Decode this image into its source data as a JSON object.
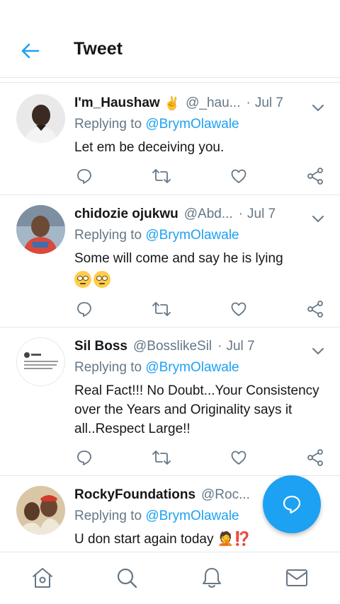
{
  "header": {
    "title": "Tweet"
  },
  "colors": {
    "accent": "#1da1f2",
    "text": "#14171a",
    "muted": "#657786",
    "border": "#e1e8ed"
  },
  "tweets": [
    {
      "name": "I'm_Haushaw",
      "name_emoji": "✌️",
      "handle": "@_hau...",
      "sep": "·",
      "date": "Jul 7",
      "replying_prefix": "Replying to ",
      "mention": "@BrymOlawale",
      "text": "Let em be deceiving you."
    },
    {
      "name": "chidozie ojukwu",
      "handle": "@Abd...",
      "sep": "·",
      "date": "Jul 7",
      "replying_prefix": "Replying to ",
      "mention": "@BrymOlawale",
      "text": "Some will come and say he is lying"
    },
    {
      "name": "Sil Boss",
      "handle": "@BosslikeSil",
      "sep": "·",
      "date": "Jul 7",
      "replying_prefix": "Replying to ",
      "mention": "@BrymOlawale",
      "text": "Real Fact!!! No Doubt...Your Consistency over the Years and Originality says it all..Respect Large!!"
    },
    {
      "name": "RockyFoundations",
      "handle": "@Roc...",
      "sep": "·",
      "date": "",
      "replying_prefix": "Replying to ",
      "mention": "@BrymOlawale",
      "text": "U don start again today",
      "text_emoji": "🤦⁉️"
    }
  ],
  "icons": {
    "back": "arrow-left-icon",
    "reply": "reply-icon",
    "retweet": "retweet-icon",
    "like": "heart-icon",
    "share": "share-icon",
    "compose": "compose-reply-icon",
    "nav": [
      "home-icon",
      "search-icon",
      "notifications-icon",
      "messages-icon"
    ]
  }
}
